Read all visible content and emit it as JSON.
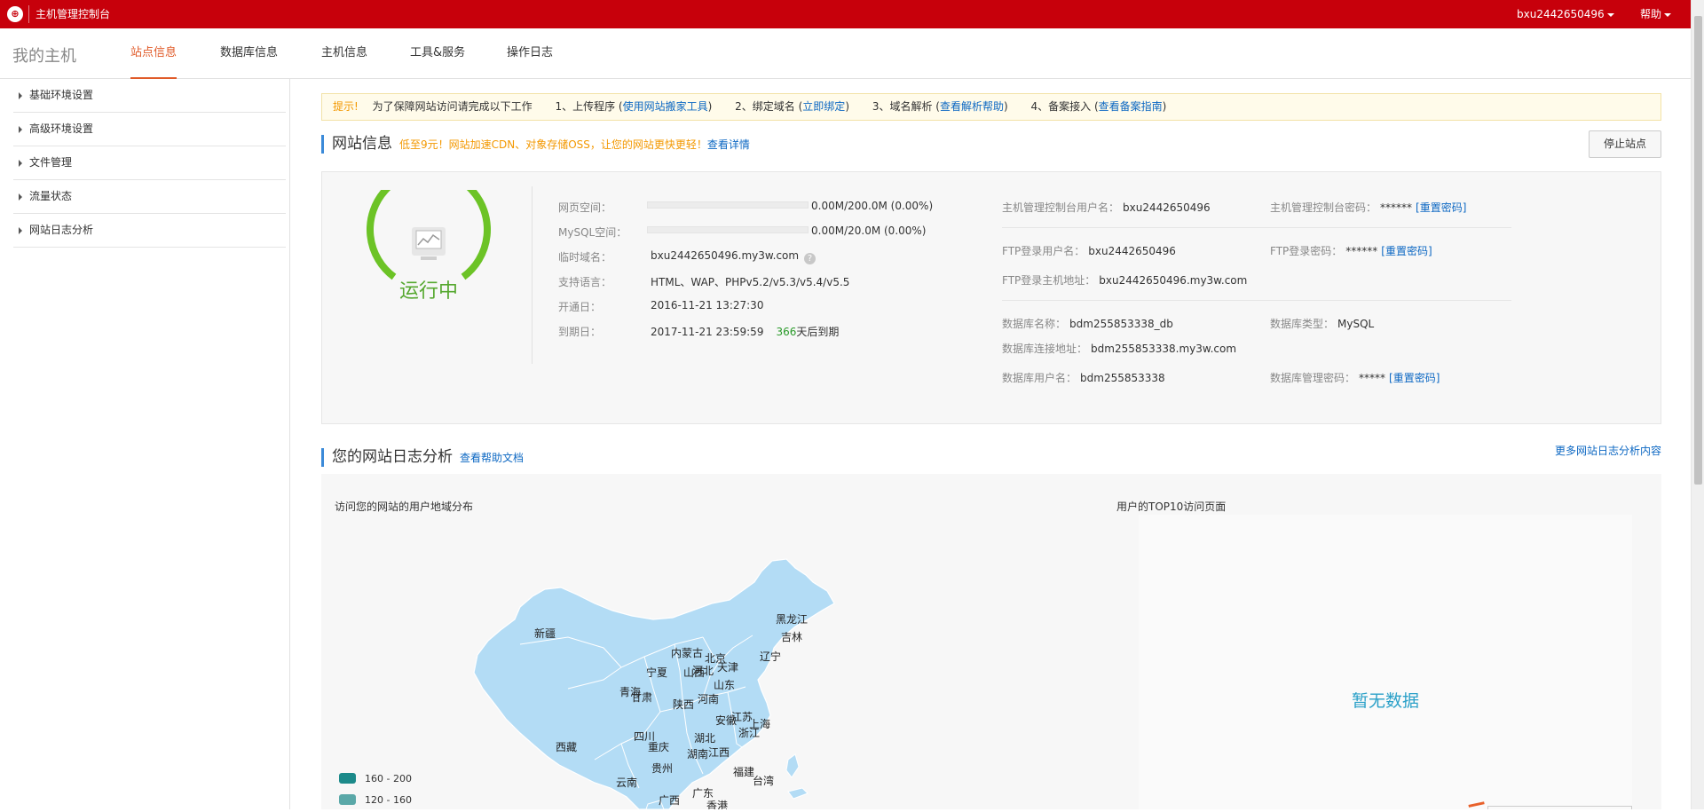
{
  "topbar": {
    "title": "主机管理控制台",
    "user": "bxu2442650496",
    "help": "帮助"
  },
  "nav": {
    "home": "我的主机",
    "tabs": [
      "站点信息",
      "数据库信息",
      "主机信息",
      "工具&服务",
      "操作日志"
    ]
  },
  "sidebar": {
    "items": [
      "基础环境设置",
      "高级环境设置",
      "文件管理",
      "流量状态",
      "网站日志分析"
    ]
  },
  "tip": {
    "label": "提示!",
    "text": "为了保障网站访问请完成以下工作",
    "step1": "1、上传程序 (",
    "step1_link": "使用网站搬家工具",
    "step1_end": ")",
    "step2": "2、绑定域名 (",
    "step2_link": "立即绑定",
    "step2_end": ")",
    "step3": "3、域名解析 (",
    "step3_link": "查看解析帮助",
    "step3_end": ")",
    "step4": "4、备案接入 (",
    "step4_link": "查看备案指南",
    "step4_end": ")"
  },
  "site_info": {
    "title": "网站信息",
    "promo": "低至9元！网站加速CDN、对象存储OSS，让您的网站更快更轻！",
    "promo_link": "查看详情",
    "stop_button": "停止站点",
    "status": "运行中",
    "web_space": {
      "label": "网页空间：",
      "value": "0.00M/200.0M (0.00%)",
      "usage": 0
    },
    "mysql_space": {
      "label": "MySQL空间：",
      "value": "0.00M/20.0M (0.00%)",
      "usage": 0
    },
    "temp_domain": {
      "label": "临时域名：",
      "value": "bxu2442650496.my3w.com"
    },
    "languages": {
      "label": "支持语言：",
      "value": "HTML、WAP、PHPv5.2/v5.3/v5.4/v5.5"
    },
    "open_date": {
      "label": "开通日：",
      "value": "2016-11-21 13:27:30"
    },
    "expire_date": {
      "label": "到期日：",
      "value": "2017-11-21 23:59:59",
      "days": "366",
      "days_suffix": "天后到期"
    },
    "console_user": {
      "label": "主机管理控制台用户名：",
      "value": "bxu2442650496"
    },
    "console_pwd": {
      "label": "主机管理控制台密码：",
      "value": "******",
      "link": "[重置密码]"
    },
    "ftp_user": {
      "label": "FTP登录用户名：",
      "value": "bxu2442650496"
    },
    "ftp_pwd": {
      "label": "FTP登录密码：",
      "value": "******",
      "link": "[重置密码]"
    },
    "ftp_host": {
      "label": "FTP登录主机地址：",
      "value": "bxu2442650496.my3w.com"
    },
    "db_name": {
      "label": "数据库名称：",
      "value": "bdm255853338_db"
    },
    "db_type": {
      "label": "数据库类型：",
      "value": "MySQL"
    },
    "db_host": {
      "label": "数据库连接地址：",
      "value": "bdm255853338.my3w.com"
    },
    "db_user": {
      "label": "数据库用户名：",
      "value": "bdm255853338"
    },
    "db_pwd": {
      "label": "数据库管理密码：",
      "value": "*****",
      "link": "[重置密码]"
    }
  },
  "log_analysis": {
    "title": "您的网站日志分析",
    "help_link": "查看帮助文档",
    "more_link": "更多网站日志分析内容",
    "map_title": "访问您的网站的用户地域分布",
    "top10_title": "用户的TOP10访问页面",
    "nodata": "暂无数据",
    "map_fill": "#b3dcf5",
    "legend": [
      {
        "range": "160 - 200",
        "color": "#1c8a8a"
      },
      {
        "range": "120 - 160",
        "color": "#5aa8a8"
      }
    ],
    "provinces": [
      "新疆",
      "西藏",
      "青海",
      "甘肃",
      "宁夏",
      "内蒙古",
      "北京",
      "天津",
      "河北",
      "山西",
      "山东",
      "陕西",
      "河南",
      "四川",
      "重庆",
      "湖北",
      "安徽",
      "江苏",
      "上海",
      "浙江",
      "湖南",
      "江西",
      "贵州",
      "云南",
      "广西",
      "广东",
      "福建",
      "台湾",
      "香港",
      "黑龙江",
      "吉林",
      "辽宁"
    ]
  },
  "colors": {
    "brand": "#c7000b",
    "accent": "#e05a28",
    "link": "#0d68c3",
    "running": "#6cc326"
  }
}
